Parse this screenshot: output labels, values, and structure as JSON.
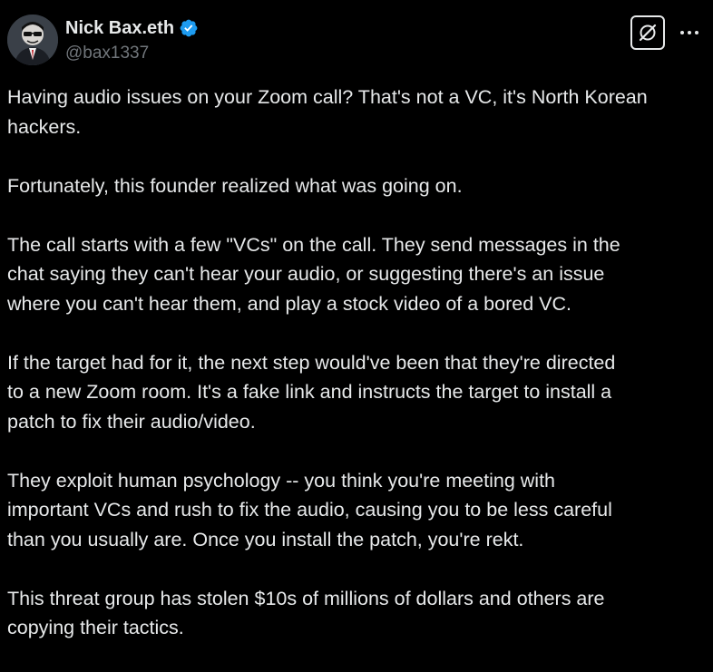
{
  "author": {
    "display_name": "Nick Bax.eth",
    "handle": "@bax1337",
    "verified": true,
    "avatar_icon": "avatar-icon"
  },
  "actions": {
    "grok_icon": "grok-icon",
    "more_icon": "more-dots-icon"
  },
  "colors": {
    "background": "#000000",
    "text": "#e7e9ea",
    "secondary_text": "#71767b",
    "verified_badge": "#1d9bf0"
  },
  "post": {
    "paragraphs": [
      "Having audio issues on your Zoom call? That's not a VC, it's North Korean\nhackers.",
      "Fortunately, this founder realized what was going on.",
      "The call starts with a few \"VCs\" on the call. They send messages in the\nchat saying they can't hear your audio, or suggesting there's an issue\nwhere you can't hear them, and play a stock video of a bored VC.",
      "If the target had for it, the next step would've been that they're directed\nto a new Zoom room. It's a fake link and instructs the target to install a\npatch to fix their audio/video.",
      "They exploit human psychology -- you think you're meeting with\nimportant VCs and rush to fix the audio, causing you to be less careful\nthan you usually are. Once you install the patch, you're rekt.",
      "This threat group has stolen $10s of millions of dollars and others are\ncopying their tactics."
    ]
  }
}
